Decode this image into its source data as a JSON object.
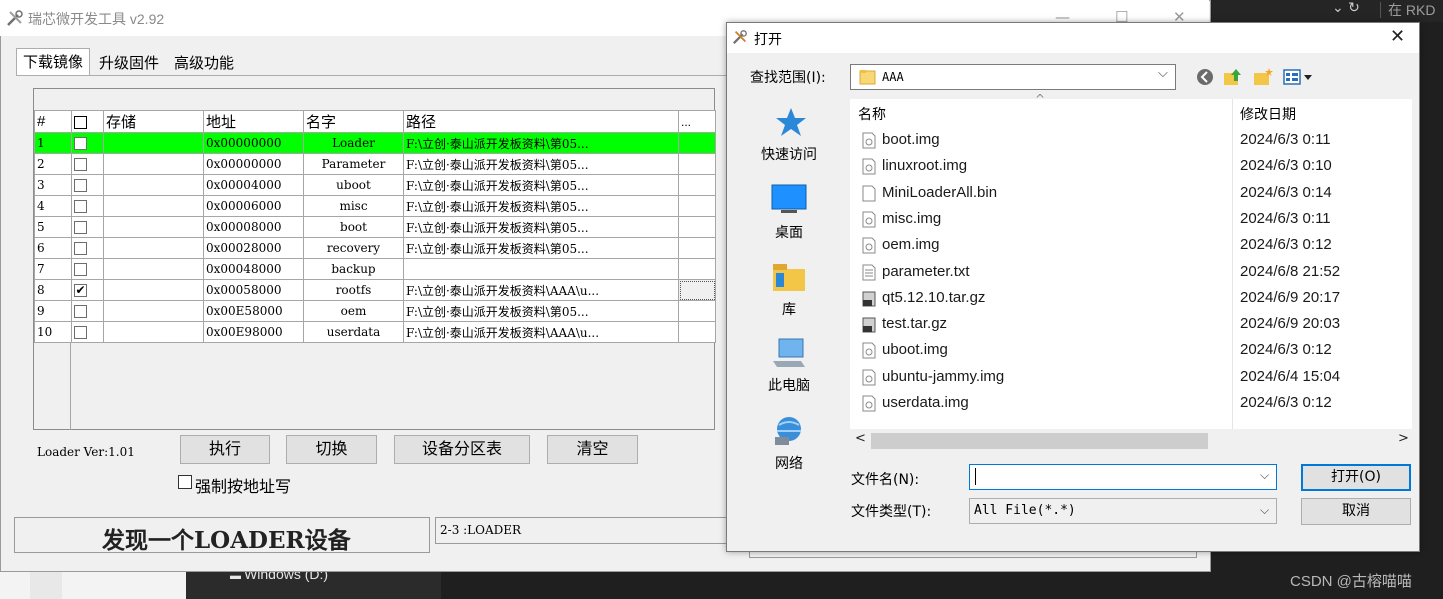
{
  "background": {
    "drive_label": "Windows (D:)",
    "top_text": "在 RKD",
    "watermark": "CSDN @古榕喵喵"
  },
  "tool": {
    "title": "瑞芯微开发工具 v2.92",
    "tabs": [
      "下载镜像",
      "升级固件",
      "高级功能"
    ],
    "columns": [
      "#",
      "存储",
      "地址",
      "名字",
      "路径",
      "..."
    ],
    "rows": [
      {
        "num": "1",
        "checked": false,
        "highlight": true,
        "addr": "0x00000000",
        "name": "Loader",
        "path": "F:\\立创·泰山派开发板资料\\第05..."
      },
      {
        "num": "2",
        "checked": false,
        "highlight": false,
        "addr": "0x00000000",
        "name": "Parameter",
        "path": "F:\\立创·泰山派开发板资料\\第05..."
      },
      {
        "num": "3",
        "checked": false,
        "highlight": false,
        "addr": "0x00004000",
        "name": "uboot",
        "path": "F:\\立创·泰山派开发板资料\\第05..."
      },
      {
        "num": "4",
        "checked": false,
        "highlight": false,
        "addr": "0x00006000",
        "name": "misc",
        "path": "F:\\立创·泰山派开发板资料\\第05..."
      },
      {
        "num": "5",
        "checked": false,
        "highlight": false,
        "addr": "0x00008000",
        "name": "boot",
        "path": "F:\\立创·泰山派开发板资料\\第05..."
      },
      {
        "num": "6",
        "checked": false,
        "highlight": false,
        "addr": "0x00028000",
        "name": "recovery",
        "path": "F:\\立创·泰山派开发板资料\\第05..."
      },
      {
        "num": "7",
        "checked": false,
        "highlight": false,
        "addr": "0x00048000",
        "name": "backup",
        "path": ""
      },
      {
        "num": "8",
        "checked": true,
        "highlight": false,
        "addr": "0x00058000",
        "name": "rootfs",
        "path": "F:\\立创·泰山派开发板资料\\AAA\\u..."
      },
      {
        "num": "9",
        "checked": false,
        "highlight": false,
        "addr": "0x00E58000",
        "name": "oem",
        "path": "F:\\立创·泰山派开发板资料\\第05..."
      },
      {
        "num": "10",
        "checked": false,
        "highlight": false,
        "addr": "0x00E98000",
        "name": "userdata",
        "path": "F:\\立创·泰山派开发板资料\\AAA\\u..."
      }
    ],
    "loader_ver": "Loader Ver:1.01",
    "buttons": {
      "run": "执行",
      "switch": "切换",
      "partition": "设备分区表",
      "clear": "清空"
    },
    "force_addr_label": "强制按地址写",
    "status": "发现一个LOADER设备",
    "device": "2-3 :LOADER",
    "highlight_color": "#00ff00"
  },
  "dialog": {
    "title": "打开",
    "lookin_label": "查找范围(I):",
    "lookin_value": "AAA",
    "places": [
      "快速访问",
      "桌面",
      "库",
      "此电脑",
      "网络"
    ],
    "header_name": "名称",
    "header_date": "修改日期",
    "files": [
      {
        "name": "boot.img",
        "date": "2024/6/3 0:11",
        "icon": "image-file-icon"
      },
      {
        "name": "linuxroot.img",
        "date": "2024/6/3 0:10",
        "icon": "image-file-icon"
      },
      {
        "name": "MiniLoaderAll.bin",
        "date": "2024/6/3 0:14",
        "icon": "blank-file-icon"
      },
      {
        "name": "misc.img",
        "date": "2024/6/3 0:11",
        "icon": "image-file-icon"
      },
      {
        "name": "oem.img",
        "date": "2024/6/3 0:12",
        "icon": "image-file-icon"
      },
      {
        "name": "parameter.txt",
        "date": "2024/6/8 21:52",
        "icon": "text-file-icon"
      },
      {
        "name": "qt5.12.10.tar.gz",
        "date": "2024/6/9 20:17",
        "icon": "archive-file-icon"
      },
      {
        "name": "test.tar.gz",
        "date": "2024/6/9 20:03",
        "icon": "archive-file-icon"
      },
      {
        "name": "uboot.img",
        "date": "2024/6/3 0:12",
        "icon": "image-file-icon"
      },
      {
        "name": "ubuntu-jammy.img",
        "date": "2024/6/4 15:04",
        "icon": "image-file-icon"
      },
      {
        "name": "userdata.img",
        "date": "2024/6/3 0:12",
        "icon": "image-file-icon"
      }
    ],
    "filename_label": "文件名(N):",
    "filename_value": "",
    "filetype_label": "文件类型(T):",
    "filetype_value": "All File(*.*)",
    "open_label": "打开(O)",
    "cancel_label": "取消"
  }
}
